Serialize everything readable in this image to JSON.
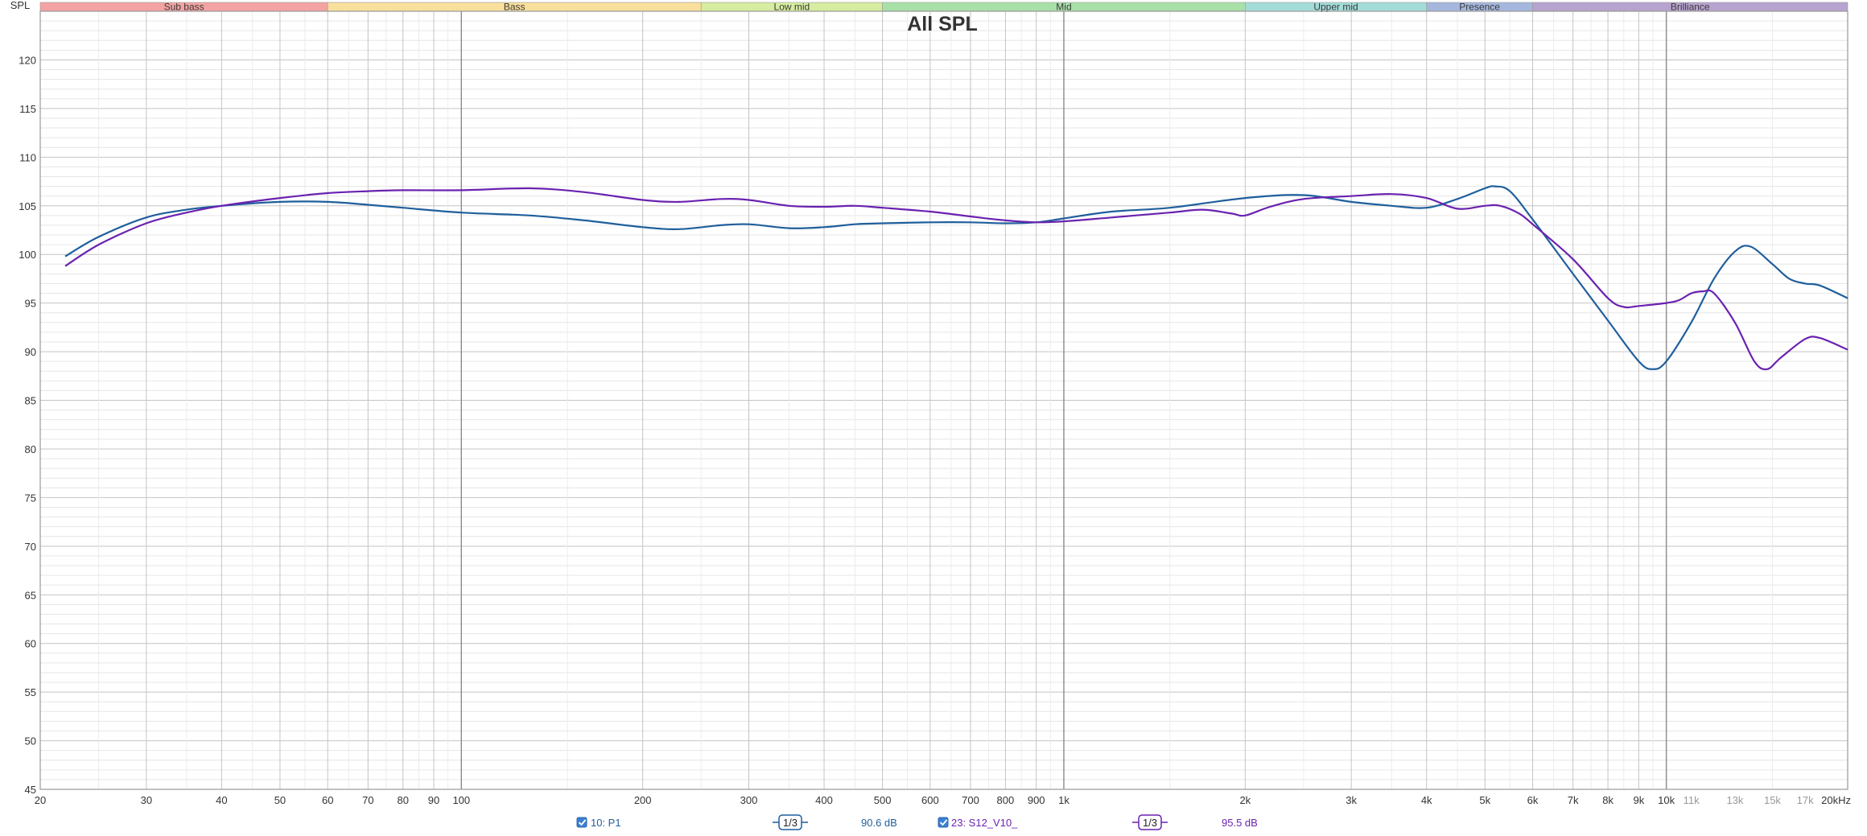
{
  "chart_data": {
    "type": "line",
    "title": "All SPL",
    "ylabel": "SPL",
    "xscale": "log",
    "xlim": [
      20,
      20000
    ],
    "ylim": [
      45,
      125
    ],
    "grid": true,
    "y_ticks": [
      45,
      50,
      55,
      60,
      65,
      70,
      75,
      80,
      85,
      90,
      95,
      100,
      105,
      110,
      115,
      120
    ],
    "x_ticks": [
      {
        "v": 20,
        "label": "20"
      },
      {
        "v": 30,
        "label": "30"
      },
      {
        "v": 40,
        "label": "40"
      },
      {
        "v": 50,
        "label": "50"
      },
      {
        "v": 60,
        "label": "60"
      },
      {
        "v": 70,
        "label": "70"
      },
      {
        "v": 80,
        "label": "80"
      },
      {
        "v": 90,
        "label": "90"
      },
      {
        "v": 100,
        "label": "100"
      },
      {
        "v": 200,
        "label": "200"
      },
      {
        "v": 300,
        "label": "300"
      },
      {
        "v": 400,
        "label": "400"
      },
      {
        "v": 500,
        "label": "500"
      },
      {
        "v": 600,
        "label": "600"
      },
      {
        "v": 700,
        "label": "700"
      },
      {
        "v": 800,
        "label": "800"
      },
      {
        "v": 900,
        "label": "900"
      },
      {
        "v": 1000,
        "label": "1k"
      },
      {
        "v": 2000,
        "label": "2k"
      },
      {
        "v": 3000,
        "label": "3k"
      },
      {
        "v": 4000,
        "label": "4k"
      },
      {
        "v": 5000,
        "label": "5k"
      },
      {
        "v": 6000,
        "label": "6k"
      },
      {
        "v": 7000,
        "label": "7k"
      },
      {
        "v": 8000,
        "label": "8k"
      },
      {
        "v": 9000,
        "label": "9k"
      },
      {
        "v": 10000,
        "label": "10k"
      },
      {
        "v": 11000,
        "label": "11k",
        "dim": true
      },
      {
        "v": 13000,
        "label": "13k",
        "dim": true
      },
      {
        "v": 15000,
        "label": "15k",
        "dim": true
      },
      {
        "v": 17000,
        "label": "17k",
        "dim": true
      },
      {
        "v": 20000,
        "label": "20kHz"
      }
    ],
    "bands": [
      {
        "name": "Sub bass",
        "from": 20,
        "to": 60,
        "color": "#f4a3a3"
      },
      {
        "name": "Bass",
        "from": 60,
        "to": 250,
        "color": "#f9df9c"
      },
      {
        "name": "Low mid",
        "from": 250,
        "to": 500,
        "color": "#d6eca0"
      },
      {
        "name": "Mid",
        "from": 500,
        "to": 2000,
        "color": "#a8e0a8"
      },
      {
        "name": "Upper mid",
        "from": 2000,
        "to": 4000,
        "color": "#a3dcd9"
      },
      {
        "name": "Presence",
        "from": 4000,
        "to": 6000,
        "color": "#a5b7dd"
      },
      {
        "name": "Brilliance",
        "from": 6000,
        "to": 20000,
        "color": "#b7a3cf"
      }
    ],
    "series": [
      {
        "name": "10: P1",
        "color": "#1f5f9c",
        "points": [
          [
            22,
            99.8
          ],
          [
            25,
            101.8
          ],
          [
            30,
            103.8
          ],
          [
            35,
            104.6
          ],
          [
            40,
            105.0
          ],
          [
            50,
            105.4
          ],
          [
            60,
            105.4
          ],
          [
            70,
            105.1
          ],
          [
            80,
            104.8
          ],
          [
            100,
            104.3
          ],
          [
            130,
            104.0
          ],
          [
            160,
            103.5
          ],
          [
            200,
            102.8
          ],
          [
            230,
            102.6
          ],
          [
            270,
            103.0
          ],
          [
            300,
            103.1
          ],
          [
            350,
            102.7
          ],
          [
            400,
            102.8
          ],
          [
            450,
            103.1
          ],
          [
            500,
            103.2
          ],
          [
            600,
            103.3
          ],
          [
            700,
            103.3
          ],
          [
            800,
            103.2
          ],
          [
            900,
            103.3
          ],
          [
            1000,
            103.7
          ],
          [
            1200,
            104.4
          ],
          [
            1500,
            104.8
          ],
          [
            2000,
            105.8
          ],
          [
            2500,
            106.1
          ],
          [
            3000,
            105.4
          ],
          [
            3500,
            105.0
          ],
          [
            4000,
            104.8
          ],
          [
            4500,
            105.7
          ],
          [
            5000,
            106.8
          ],
          [
            5200,
            107.0
          ],
          [
            5500,
            106.5
          ],
          [
            6000,
            103.6
          ],
          [
            7000,
            98.0
          ],
          [
            8000,
            93.2
          ],
          [
            9000,
            89.0
          ],
          [
            9500,
            88.2
          ],
          [
            10000,
            89.0
          ],
          [
            11000,
            93.0
          ],
          [
            12000,
            97.5
          ],
          [
            13000,
            100.3
          ],
          [
            13800,
            100.8
          ],
          [
            15000,
            99.0
          ],
          [
            16000,
            97.5
          ],
          [
            17000,
            97.0
          ],
          [
            18000,
            96.8
          ],
          [
            20000,
            95.5
          ]
        ]
      },
      {
        "name": "23: S12_V10_",
        "color": "#6a22b0",
        "points": [
          [
            22,
            98.8
          ],
          [
            25,
            101.0
          ],
          [
            30,
            103.2
          ],
          [
            35,
            104.3
          ],
          [
            40,
            105.0
          ],
          [
            50,
            105.8
          ],
          [
            60,
            106.3
          ],
          [
            70,
            106.5
          ],
          [
            80,
            106.6
          ],
          [
            100,
            106.6
          ],
          [
            130,
            106.8
          ],
          [
            160,
            106.4
          ],
          [
            200,
            105.6
          ],
          [
            230,
            105.4
          ],
          [
            270,
            105.7
          ],
          [
            300,
            105.6
          ],
          [
            350,
            105.0
          ],
          [
            400,
            104.9
          ],
          [
            450,
            105.0
          ],
          [
            500,
            104.8
          ],
          [
            600,
            104.4
          ],
          [
            700,
            103.9
          ],
          [
            800,
            103.5
          ],
          [
            900,
            103.3
          ],
          [
            1000,
            103.4
          ],
          [
            1200,
            103.8
          ],
          [
            1500,
            104.3
          ],
          [
            1700,
            104.6
          ],
          [
            1900,
            104.2
          ],
          [
            2000,
            104.0
          ],
          [
            2200,
            104.9
          ],
          [
            2500,
            105.7
          ],
          [
            3000,
            106.0
          ],
          [
            3500,
            106.2
          ],
          [
            4000,
            105.8
          ],
          [
            4500,
            104.7
          ],
          [
            5000,
            105.0
          ],
          [
            5300,
            105.0
          ],
          [
            5700,
            104.2
          ],
          [
            6000,
            103.1
          ],
          [
            7000,
            99.5
          ],
          [
            8000,
            95.5
          ],
          [
            8500,
            94.6
          ],
          [
            9000,
            94.7
          ],
          [
            10000,
            95.0
          ],
          [
            10500,
            95.3
          ],
          [
            11000,
            96.0
          ],
          [
            11500,
            96.2
          ],
          [
            12000,
            96.0
          ],
          [
            13000,
            93.0
          ],
          [
            14000,
            89.0
          ],
          [
            14700,
            88.2
          ],
          [
            15500,
            89.4
          ],
          [
            17000,
            91.3
          ],
          [
            18000,
            91.4
          ],
          [
            20000,
            90.2
          ]
        ]
      }
    ],
    "legend": [
      {
        "checked": true,
        "label": "10: P1",
        "smoothing": "1/3",
        "level": "90.6 dB",
        "color": "#1f5f9c"
      },
      {
        "checked": true,
        "label": "23: S12_V10_",
        "smoothing": "1/3",
        "level": "95.5 dB",
        "color": "#6a22b0"
      }
    ]
  }
}
